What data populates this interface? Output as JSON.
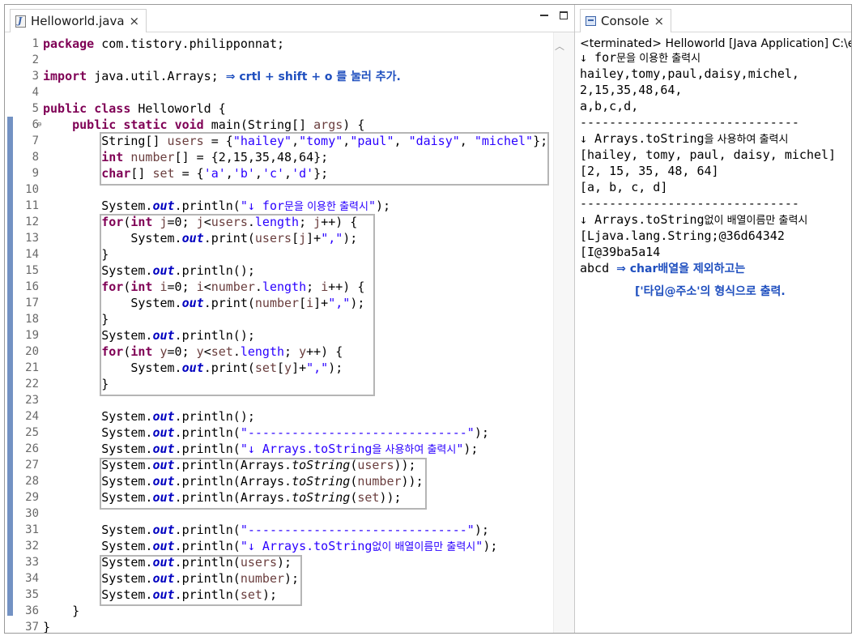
{
  "editor": {
    "tab_title": "Helloworld.java",
    "tab_close": "×",
    "lines": [
      {
        "n": "1",
        "parts": [
          {
            "t": "package",
            "c": "kw"
          },
          {
            "t": " com.tistory.philipponnat;"
          }
        ]
      },
      {
        "n": "2",
        "parts": []
      },
      {
        "n": "3",
        "parts": [
          {
            "t": "import",
            "c": "kw"
          },
          {
            "t": " java.util.Arrays; "
          },
          {
            "t": "⇒ crtl + shift + o 를 눌러 추가.",
            "c": "note"
          }
        ]
      },
      {
        "n": "4",
        "parts": []
      },
      {
        "n": "5",
        "parts": [
          {
            "t": "public",
            "c": "kw"
          },
          {
            "t": " "
          },
          {
            "t": "class",
            "c": "kw"
          },
          {
            "t": " Helloworld {"
          }
        ]
      },
      {
        "n": "6",
        "fold": "⊖",
        "parts": [
          {
            "t": "    "
          },
          {
            "t": "public",
            "c": "kw"
          },
          {
            "t": " "
          },
          {
            "t": "static",
            "c": "kw"
          },
          {
            "t": " "
          },
          {
            "t": "void",
            "c": "kw"
          },
          {
            "t": " main(String[] "
          },
          {
            "t": "args",
            "c": "var"
          },
          {
            "t": ") {"
          }
        ]
      },
      {
        "n": "7",
        "parts": [
          {
            "t": "        String[] "
          },
          {
            "t": "users",
            "c": "var"
          },
          {
            "t": " = {"
          },
          {
            "t": "\"hailey\"",
            "c": "str"
          },
          {
            "t": ","
          },
          {
            "t": "\"tomy\"",
            "c": "str"
          },
          {
            "t": ","
          },
          {
            "t": "\"paul\"",
            "c": "str"
          },
          {
            "t": ", "
          },
          {
            "t": "\"daisy\"",
            "c": "str"
          },
          {
            "t": ", "
          },
          {
            "t": "\"michel\"",
            "c": "str"
          },
          {
            "t": "};"
          }
        ]
      },
      {
        "n": "8",
        "parts": [
          {
            "t": "        "
          },
          {
            "t": "int",
            "c": "kw"
          },
          {
            "t": " "
          },
          {
            "t": "number",
            "c": "var"
          },
          {
            "t": "[] = {2,15,35,48,64};"
          }
        ]
      },
      {
        "n": "9",
        "parts": [
          {
            "t": "        "
          },
          {
            "t": "char",
            "c": "kw"
          },
          {
            "t": "[] "
          },
          {
            "t": "set",
            "c": "var"
          },
          {
            "t": " = {"
          },
          {
            "t": "'a'",
            "c": "str"
          },
          {
            "t": ","
          },
          {
            "t": "'b'",
            "c": "str"
          },
          {
            "t": ","
          },
          {
            "t": "'c'",
            "c": "str"
          },
          {
            "t": ","
          },
          {
            "t": "'d'",
            "c": "str"
          },
          {
            "t": "};"
          }
        ]
      },
      {
        "n": "10",
        "parts": []
      },
      {
        "n": "11",
        "parts": [
          {
            "t": "        System."
          },
          {
            "t": "out",
            "c": "fld"
          },
          {
            "t": ".println("
          },
          {
            "t": "\"↓ for",
            "c": "str"
          },
          {
            "t": "문을 이용한 출력시",
            "c": "str kr"
          },
          {
            "t": "\"",
            "c": "str"
          },
          {
            "t": ");"
          }
        ]
      },
      {
        "n": "12",
        "parts": [
          {
            "t": "        "
          },
          {
            "t": "for",
            "c": "kw"
          },
          {
            "t": "("
          },
          {
            "t": "int",
            "c": "kw"
          },
          {
            "t": " "
          },
          {
            "t": "j",
            "c": "var"
          },
          {
            "t": "=0; "
          },
          {
            "t": "j",
            "c": "var"
          },
          {
            "t": "<"
          },
          {
            "t": "users",
            "c": "var"
          },
          {
            "t": "."
          },
          {
            "t": "length",
            "c": "str"
          },
          {
            "t": "; "
          },
          {
            "t": "j",
            "c": "var"
          },
          {
            "t": "++) {"
          }
        ]
      },
      {
        "n": "13",
        "parts": [
          {
            "t": "            System."
          },
          {
            "t": "out",
            "c": "fld"
          },
          {
            "t": ".print("
          },
          {
            "t": "users",
            "c": "var"
          },
          {
            "t": "["
          },
          {
            "t": "j",
            "c": "var"
          },
          {
            "t": "]+"
          },
          {
            "t": "\",\"",
            "c": "str"
          },
          {
            "t": ");"
          }
        ]
      },
      {
        "n": "14",
        "parts": [
          {
            "t": "        }"
          }
        ]
      },
      {
        "n": "15",
        "parts": [
          {
            "t": "        System."
          },
          {
            "t": "out",
            "c": "fld"
          },
          {
            "t": ".println();"
          }
        ]
      },
      {
        "n": "16",
        "parts": [
          {
            "t": "        "
          },
          {
            "t": "for",
            "c": "kw"
          },
          {
            "t": "("
          },
          {
            "t": "int",
            "c": "kw"
          },
          {
            "t": " "
          },
          {
            "t": "i",
            "c": "var"
          },
          {
            "t": "=0; "
          },
          {
            "t": "i",
            "c": "var"
          },
          {
            "t": "<"
          },
          {
            "t": "number",
            "c": "var"
          },
          {
            "t": "."
          },
          {
            "t": "length",
            "c": "str"
          },
          {
            "t": "; "
          },
          {
            "t": "i",
            "c": "var"
          },
          {
            "t": "++) {"
          }
        ]
      },
      {
        "n": "17",
        "parts": [
          {
            "t": "            System."
          },
          {
            "t": "out",
            "c": "fld"
          },
          {
            "t": ".print("
          },
          {
            "t": "number",
            "c": "var"
          },
          {
            "t": "["
          },
          {
            "t": "i",
            "c": "var"
          },
          {
            "t": "]+"
          },
          {
            "t": "\",\"",
            "c": "str"
          },
          {
            "t": ");"
          }
        ]
      },
      {
        "n": "18",
        "parts": [
          {
            "t": "        }"
          }
        ]
      },
      {
        "n": "19",
        "parts": [
          {
            "t": "        System."
          },
          {
            "t": "out",
            "c": "fld"
          },
          {
            "t": ".println();"
          }
        ]
      },
      {
        "n": "20",
        "parts": [
          {
            "t": "        "
          },
          {
            "t": "for",
            "c": "kw"
          },
          {
            "t": "("
          },
          {
            "t": "int",
            "c": "kw"
          },
          {
            "t": " "
          },
          {
            "t": "y",
            "c": "var"
          },
          {
            "t": "=0; "
          },
          {
            "t": "y",
            "c": "var"
          },
          {
            "t": "<"
          },
          {
            "t": "set",
            "c": "var"
          },
          {
            "t": "."
          },
          {
            "t": "length",
            "c": "str"
          },
          {
            "t": "; "
          },
          {
            "t": "y",
            "c": "var"
          },
          {
            "t": "++) {"
          }
        ]
      },
      {
        "n": "21",
        "parts": [
          {
            "t": "            System."
          },
          {
            "t": "out",
            "c": "fld"
          },
          {
            "t": ".print("
          },
          {
            "t": "set",
            "c": "var"
          },
          {
            "t": "["
          },
          {
            "t": "y",
            "c": "var"
          },
          {
            "t": "]+"
          },
          {
            "t": "\",\"",
            "c": "str"
          },
          {
            "t": ");"
          }
        ]
      },
      {
        "n": "22",
        "parts": [
          {
            "t": "        }"
          }
        ]
      },
      {
        "n": "23",
        "parts": []
      },
      {
        "n": "24",
        "parts": [
          {
            "t": "        System."
          },
          {
            "t": "out",
            "c": "fld"
          },
          {
            "t": ".println();"
          }
        ]
      },
      {
        "n": "25",
        "parts": [
          {
            "t": "        System."
          },
          {
            "t": "out",
            "c": "fld"
          },
          {
            "t": ".println("
          },
          {
            "t": "\"------------------------------\"",
            "c": "str"
          },
          {
            "t": ");"
          }
        ]
      },
      {
        "n": "26",
        "parts": [
          {
            "t": "        System."
          },
          {
            "t": "out",
            "c": "fld"
          },
          {
            "t": ".println("
          },
          {
            "t": "\"↓ Arrays.toString",
            "c": "str"
          },
          {
            "t": "을 사용하여 출력시",
            "c": "str kr"
          },
          {
            "t": "\"",
            "c": "str"
          },
          {
            "t": ");"
          }
        ]
      },
      {
        "n": "27",
        "parts": [
          {
            "t": "        System."
          },
          {
            "t": "out",
            "c": "fld"
          },
          {
            "t": ".println(Arrays."
          },
          {
            "t": "toString",
            "c": "mth"
          },
          {
            "t": "("
          },
          {
            "t": "users",
            "c": "var"
          },
          {
            "t": "));"
          }
        ]
      },
      {
        "n": "28",
        "parts": [
          {
            "t": "        System."
          },
          {
            "t": "out",
            "c": "fld"
          },
          {
            "t": ".println(Arrays."
          },
          {
            "t": "toString",
            "c": "mth"
          },
          {
            "t": "("
          },
          {
            "t": "number",
            "c": "var"
          },
          {
            "t": "));"
          }
        ]
      },
      {
        "n": "29",
        "parts": [
          {
            "t": "        System."
          },
          {
            "t": "out",
            "c": "fld"
          },
          {
            "t": ".println(Arrays."
          },
          {
            "t": "toString",
            "c": "mth"
          },
          {
            "t": "("
          },
          {
            "t": "set",
            "c": "var"
          },
          {
            "t": "));"
          }
        ]
      },
      {
        "n": "30",
        "parts": []
      },
      {
        "n": "31",
        "parts": [
          {
            "t": "        System."
          },
          {
            "t": "out",
            "c": "fld"
          },
          {
            "t": ".println("
          },
          {
            "t": "\"------------------------------\"",
            "c": "str"
          },
          {
            "t": ");"
          }
        ]
      },
      {
        "n": "32",
        "parts": [
          {
            "t": "        System."
          },
          {
            "t": "out",
            "c": "fld"
          },
          {
            "t": ".println("
          },
          {
            "t": "\"↓ Arrays.toString",
            "c": "str"
          },
          {
            "t": "없이 배열이름만 출력시",
            "c": "str kr"
          },
          {
            "t": "\"",
            "c": "str"
          },
          {
            "t": ");"
          }
        ]
      },
      {
        "n": "33",
        "parts": [
          {
            "t": "        System."
          },
          {
            "t": "out",
            "c": "fld"
          },
          {
            "t": ".println("
          },
          {
            "t": "users",
            "c": "var"
          },
          {
            "t": ");"
          }
        ]
      },
      {
        "n": "34",
        "parts": [
          {
            "t": "        System."
          },
          {
            "t": "out",
            "c": "fld"
          },
          {
            "t": ".println("
          },
          {
            "t": "number",
            "c": "var"
          },
          {
            "t": ");"
          }
        ]
      },
      {
        "n": "35",
        "parts": [
          {
            "t": "        System."
          },
          {
            "t": "out",
            "c": "fld"
          },
          {
            "t": ".println("
          },
          {
            "t": "set",
            "c": "var"
          },
          {
            "t": ");"
          }
        ]
      },
      {
        "n": "36",
        "parts": [
          {
            "t": "    }"
          }
        ]
      },
      {
        "n": "37",
        "parts": [
          {
            "t": "}"
          }
        ]
      }
    ]
  },
  "console": {
    "tab_title": "Console",
    "tab_close": "×",
    "status": "<terminated> Helloworld [Java Application] C:\\eclipse",
    "lines": [
      {
        "parts": [
          {
            "t": "↓ for"
          },
          {
            "t": "문을 이용한 출력시",
            "c": "kr"
          }
        ]
      },
      {
        "parts": [
          {
            "t": "hailey,tomy,paul,daisy,michel,"
          }
        ]
      },
      {
        "parts": [
          {
            "t": "2,15,35,48,64,"
          }
        ]
      },
      {
        "parts": [
          {
            "t": "a,b,c,d,"
          }
        ]
      },
      {
        "parts": [
          {
            "t": "------------------------------"
          }
        ]
      },
      {
        "parts": [
          {
            "t": "↓ Arrays.toString"
          },
          {
            "t": "을 사용하여 출력시",
            "c": "kr"
          }
        ]
      },
      {
        "parts": [
          {
            "t": "[hailey, tomy, paul, daisy, michel]"
          }
        ]
      },
      {
        "parts": [
          {
            "t": "[2, 15, 35, 48, 64]"
          }
        ]
      },
      {
        "parts": [
          {
            "t": "[a, b, c, d]"
          }
        ]
      },
      {
        "parts": [
          {
            "t": "------------------------------"
          }
        ]
      },
      {
        "parts": [
          {
            "t": "↓ Arrays.toString"
          },
          {
            "t": "없이 배열이름만 출력시",
            "c": "kr"
          }
        ]
      },
      {
        "parts": [
          {
            "t": "[Ljava.lang.String;@36d64342"
          }
        ]
      },
      {
        "parts": [
          {
            "t": "[I@39ba5a14"
          }
        ]
      },
      {
        "parts": [
          {
            "t": "abcd "
          },
          {
            "t": "⇒ char배열을 제외하고는",
            "c": "note"
          }
        ]
      }
    ],
    "note2": "['타입@주소'의 형식으로 출력."
  }
}
